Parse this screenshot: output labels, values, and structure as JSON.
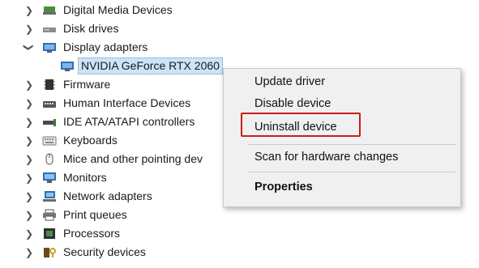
{
  "tree": {
    "items": [
      {
        "label": "Digital Media Devices",
        "icon": "digital-media-icon"
      },
      {
        "label": "Disk drives",
        "icon": "disk-drive-icon"
      },
      {
        "label": "Display adapters",
        "icon": "display-adapter-icon",
        "expanded": true
      },
      {
        "label": "NVIDIA GeForce RTX 2060",
        "icon": "gpu-icon",
        "child": true,
        "selected": true
      },
      {
        "label": "Firmware",
        "icon": "firmware-icon"
      },
      {
        "label": "Human Interface Devices",
        "icon": "hid-icon"
      },
      {
        "label": "IDE ATA/ATAPI controllers",
        "icon": "ide-controller-icon"
      },
      {
        "label": "Keyboards",
        "icon": "keyboard-icon"
      },
      {
        "label": "Mice and other pointing dev",
        "icon": "mouse-icon"
      },
      {
        "label": "Monitors",
        "icon": "monitor-icon"
      },
      {
        "label": "Network adapters",
        "icon": "network-adapter-icon"
      },
      {
        "label": "Print queues",
        "icon": "printer-icon"
      },
      {
        "label": "Processors",
        "icon": "processor-icon"
      },
      {
        "label": "Security devices",
        "icon": "security-device-icon"
      }
    ]
  },
  "context_menu": {
    "update_driver": "Update driver",
    "disable_device": "Disable device",
    "uninstall_device": "Uninstall device",
    "scan_hardware": "Scan for hardware changes",
    "properties": "Properties"
  },
  "colors": {
    "highlight_box": "#c81e1e",
    "selection_bg": "#cce4f7"
  }
}
